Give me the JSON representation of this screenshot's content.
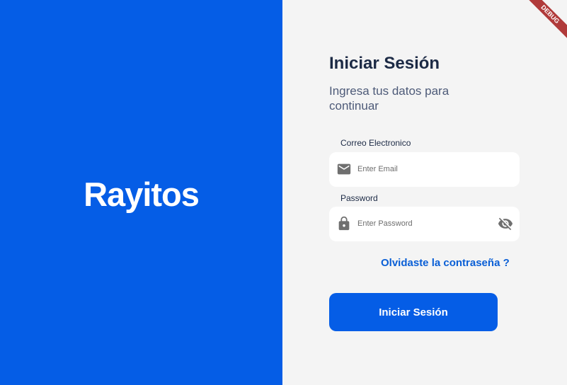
{
  "brand": {
    "name": "Rayitos"
  },
  "login": {
    "title": "Iniciar Sesión",
    "subtitle": "Ingresa tus datos para continuar",
    "email": {
      "label": "Correo Electronico",
      "placeholder": "Enter Email",
      "value": "",
      "icon": "mail-icon"
    },
    "password": {
      "label": "Password",
      "placeholder": "Enter Password",
      "value": "",
      "icon": "lock-icon",
      "toggle_icon": "visibility-off-icon"
    },
    "forgot_link": "Olvidaste la contraseña ?",
    "submit_label": "Iniciar Sesión"
  },
  "debug_banner": "DEBUG",
  "colors": {
    "primary": "#055de6",
    "background": "#f4f4f4",
    "title": "#1c2a45",
    "debug": "#b03a3a"
  }
}
